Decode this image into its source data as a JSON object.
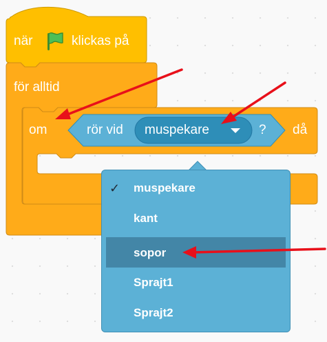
{
  "hat_block": {
    "prefix": "när",
    "flag_icon": "green-flag-icon",
    "suffix": "klickas på"
  },
  "forever_block": {
    "label": "för alltid"
  },
  "if_block": {
    "label": "om",
    "then_label": "då"
  },
  "touching_block": {
    "label": "rör vid",
    "value": "muspekare",
    "question": "?"
  },
  "dropdown": {
    "options": [
      {
        "label": "muspekare",
        "checked": true,
        "check_mark": "✓"
      },
      {
        "label": "kant"
      },
      {
        "label": "sopor",
        "highlighted": true
      },
      {
        "label": "Sprajt1"
      },
      {
        "label": "Sprajt2"
      }
    ]
  },
  "colors": {
    "control_orange": "#ffab19",
    "control_border": "#cf8b17",
    "event_yellow": "#ffbf00",
    "sensing_blue": "#5cb1d6",
    "sensing_dark": "#2e8eb8",
    "annotation_red": "#e8101a",
    "canvas": "#f9f9f9"
  }
}
